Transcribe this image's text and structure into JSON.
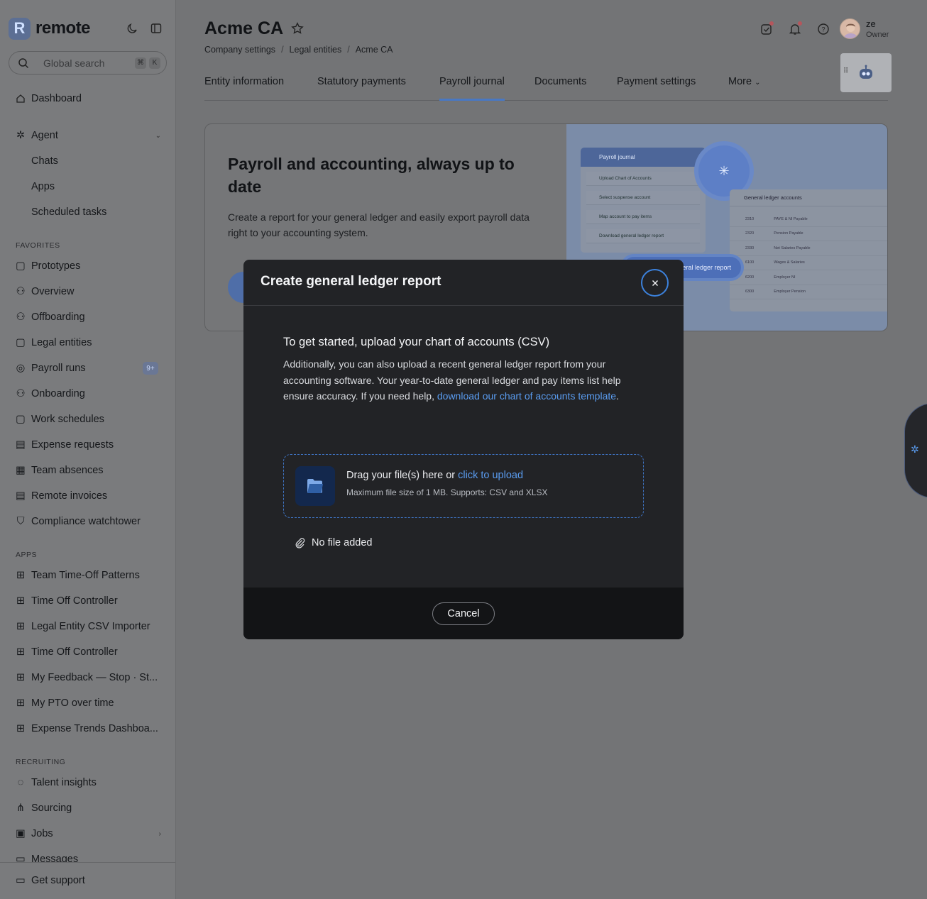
{
  "brand": {
    "name": "remote",
    "mark": "R"
  },
  "search": {
    "placeholder": "Global search",
    "key1": "⌘",
    "key2": "K"
  },
  "sidebar": {
    "dashboard": "Dashboard",
    "agent": "Agent",
    "agent_children": [
      "Chats",
      "Apps",
      "Scheduled tasks"
    ],
    "favorites_label": "FAVORITES",
    "favorites": [
      "Prototypes",
      "Overview",
      "Offboarding",
      "Legal entities",
      "Payroll runs",
      "Onboarding",
      "Work schedules",
      "Expense requests",
      "Team absences",
      "Remote invoices",
      "Compliance watchtower"
    ],
    "payroll_badge": "9+",
    "apps_label": "APPS",
    "apps": [
      "Team Time-Off Patterns",
      "Time Off Controller",
      "Legal Entity CSV Importer",
      "Time Off Controller",
      "My Feedback — Stop · St...",
      "My PTO over time",
      "Expense Trends Dashboa..."
    ],
    "recruiting_label": "RECRUITING",
    "recruiting": [
      "Talent insights",
      "Sourcing",
      "Jobs",
      "Messages"
    ],
    "support": "Get support"
  },
  "header": {
    "title": "Acme CA",
    "breadcrumb": [
      "Company settings",
      "Legal entities",
      "Acme CA"
    ],
    "user_name": "ze",
    "user_role": "Owner"
  },
  "tabs": [
    "Entity information",
    "Statutory payments",
    "Payroll journal",
    "Documents",
    "Payment settings",
    "More"
  ],
  "banner": {
    "title": "Payroll and accounting, always up to date",
    "text": "Create a report for your general ledger and easily export payroll data right to your accounting system.",
    "art": {
      "journal_title": "Payroll journal",
      "steps": [
        "Upload Chart of Accounts",
        "Select suspense account",
        "Map account to pay items",
        "Download general ledger report"
      ],
      "gl_title": "General ledger accounts",
      "gl_codes": [
        "2310",
        "2320",
        "2330",
        "6100",
        "6200",
        "6300"
      ],
      "gl_names": [
        "PAYE & NI Payable",
        "Pension Payable",
        "Net Salaries Payable",
        "Wages & Salaries",
        "Employer NI",
        "Employer Pension"
      ],
      "pill": "eral ledger report"
    }
  },
  "modal": {
    "title": "Create general ledger report",
    "heading": "To get started, upload your chart of accounts (CSV)",
    "text_before_link": "Additionally, you can also upload a recent general ledger report from your accounting software. Your year-to-date general ledger and pay items list help ensure accuracy. If you need help, ",
    "link": "download our chart of accounts template",
    "text_after_link": ".",
    "drop_text": "Drag your file(s) here or ",
    "drop_link": "click to upload",
    "drop_sub": "Maximum file size of 1 MB. Supports: CSV and XLSX",
    "no_file": "No file added",
    "cancel": "Cancel"
  },
  "colors": {
    "accent": "#4878c4",
    "link": "#5a9cf0",
    "modal_bg": "#222326"
  }
}
